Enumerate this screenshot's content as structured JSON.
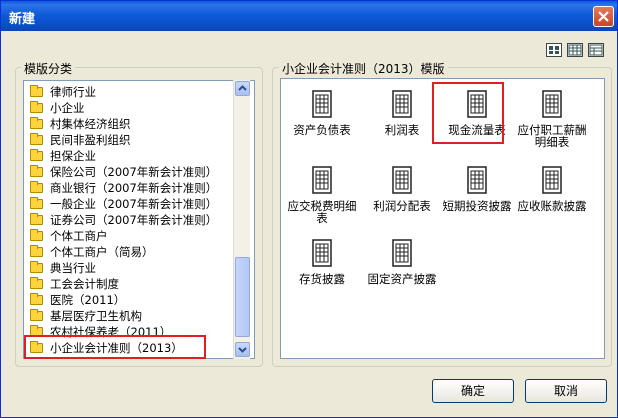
{
  "window": {
    "title": "新建"
  },
  "left_group": {
    "label": "模版分类"
  },
  "right_group": {
    "label": "小企业会计准则（2013）模版"
  },
  "categories": [
    "律师行业",
    "小企业",
    "村集体经济组织",
    "民间非盈利组织",
    "担保企业",
    "保险公司（2007年新会计准则）",
    "商业银行（2007年新会计准则）",
    "一般企业（2007年新会计准则）",
    "证券公司（2007年新会计准则）",
    "个体工商户",
    "个体工商户（简易）",
    "典当行业",
    "工会会计制度",
    "医院（2011）",
    "基层医疗卫生机构",
    "农村社保养老（2011）",
    "小企业会计准则（2013）"
  ],
  "selected_category": "小企业会计准则（2013）",
  "templates": [
    {
      "label": "资产负债表"
    },
    {
      "label": "利润表"
    },
    {
      "label": "现金流量表"
    },
    {
      "label": "应付职工薪酬明细表"
    },
    {
      "label": "应交税费明细表"
    },
    {
      "label": "利润分配表"
    },
    {
      "label": "短期投资披露"
    },
    {
      "label": "应收账款披露"
    },
    {
      "label": "存货披露"
    },
    {
      "label": "固定资产披露"
    }
  ],
  "selected_template": "现金流量表",
  "buttons": {
    "ok": "确定",
    "cancel": "取消"
  },
  "view_modes": [
    "large-icons-view",
    "list-view",
    "details-view"
  ],
  "colors": {
    "titlebar": "#0a5bd8",
    "highlight": "#e02020",
    "folder": "#fcd43b"
  }
}
